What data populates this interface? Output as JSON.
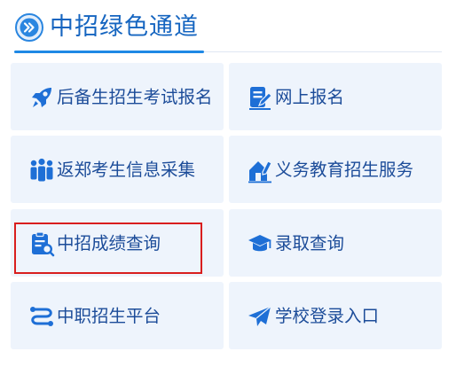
{
  "header": {
    "title": "中招绿色通道",
    "icon": "circle-arrow-icon"
  },
  "colors": {
    "accent": "#1e88e5",
    "tile_background": "#eef4fc",
    "label": "#1c4c99",
    "highlight_border": "#d91e1e"
  },
  "tiles": [
    {
      "label": "后备生招生考试报名",
      "icon": "rocket-icon"
    },
    {
      "label": "网上报名",
      "icon": "edit-document-icon"
    },
    {
      "label": "返郑考生信息采集",
      "icon": "people-group-icon"
    },
    {
      "label": "义务教育招生服务",
      "icon": "house-pen-icon"
    },
    {
      "label": "中招成绩查询",
      "icon": "clipboard-search-icon"
    },
    {
      "label": "录取查询",
      "icon": "graduation-cap-icon"
    },
    {
      "label": "中职招生平台",
      "icon": "route-icon"
    },
    {
      "label": "学校登录入口",
      "icon": "paper-plane-icon"
    }
  ],
  "highlighted_tile": "中招成绩查询"
}
